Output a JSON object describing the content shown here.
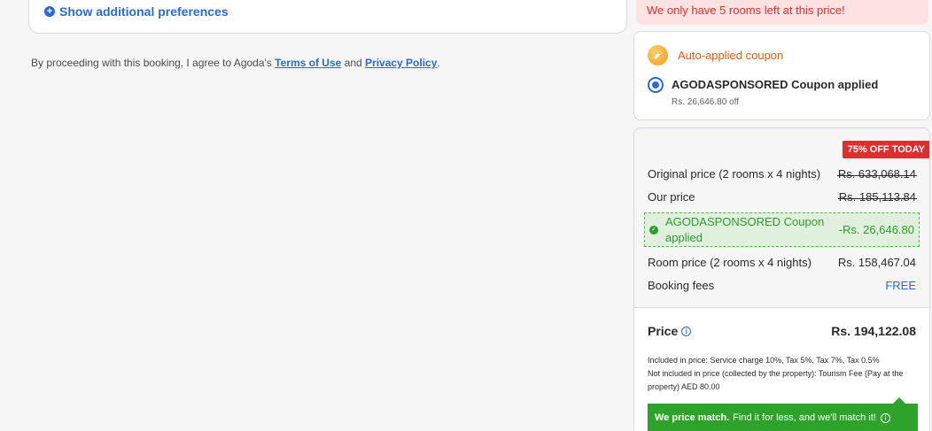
{
  "preferences": {
    "show_additional_label": "Show additional preferences"
  },
  "terms": {
    "prefix": "By proceeding with this booking, I agree to Agoda's",
    "terms_link": "Terms of Use",
    "and_text": "and",
    "privacy_link": "Privacy Policy",
    "suffix": "."
  },
  "scarcity": {
    "message": "We only have 5 rooms left at this price!"
  },
  "coupon": {
    "header_label": "Auto-applied coupon",
    "title": "AGODASPONSORED Coupon applied",
    "discount_text": "Rs. 26,646.80 off"
  },
  "pricing": {
    "badge": "75% OFF TODAY",
    "original_label": "Original price (2 rooms x 4 nights)",
    "original_value": "Rs. 633,068.14",
    "our_label": "Our price",
    "our_value": "Rs. 185,113.84",
    "coupon_label": "AGODASPONSORED Coupon applied",
    "coupon_value": "-Rs. 26,646.80",
    "room_label": "Room price (2 rooms x 4 nights)",
    "room_value": "Rs. 158,467.04",
    "fees_label": "Booking fees",
    "fees_value": "FREE",
    "total_label": "Price",
    "total_value": "Rs. 194,122.08",
    "included_note": "Included in price: Service charge 10%, Tax 5%, Tax 7%, Tax 0.5%",
    "not_included_note": "Not included in price (collected by the property): Tourism Fee (Pay at the property) AED 80.00",
    "match_bold": "We price match.",
    "match_text": "Find it for less, and we'll match it!"
  },
  "colors": {
    "accent": "#2a69d8",
    "alert": "#e12d2d",
    "success": "#2ea32a",
    "coupon_orange": "#e15c0c"
  }
}
